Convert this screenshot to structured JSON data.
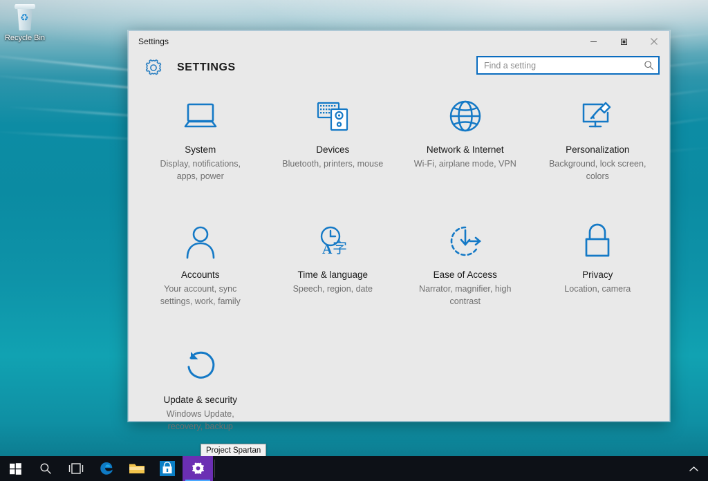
{
  "desktop": {
    "recycle_bin": {
      "label": "Recycle Bin",
      "icon": "recycle-bin-icon"
    },
    "wallpaper_colors": {
      "top": "#b9cdd4",
      "mid": "#0b8ba2",
      "bottom": "#0a6e82"
    }
  },
  "window": {
    "title": "Settings",
    "header_title": "SETTINGS",
    "header_icon": "gear-icon",
    "controls": {
      "minimize": "minimize-icon",
      "maximize": "maximize-icon",
      "close": "close-icon"
    },
    "accent_color": "#0a6cbf",
    "icon_color": "#1479c6",
    "background": "#e9e9e9"
  },
  "search": {
    "placeholder": "Find a setting",
    "value": "",
    "icon": "search-icon"
  },
  "tiles": [
    {
      "name": "System",
      "description": "Display, notifications, apps, power",
      "icon": "laptop-icon"
    },
    {
      "name": "Devices",
      "description": "Bluetooth, printers, mouse",
      "icon": "keyboard-and-speaker-icon"
    },
    {
      "name": "Network & Internet",
      "description": "Wi-Fi, airplane mode, VPN",
      "icon": "globe-icon"
    },
    {
      "name": "Personalization",
      "description": "Background, lock screen, colors",
      "icon": "monitor-paintbrush-icon"
    },
    {
      "name": "Accounts",
      "description": "Your account, sync settings, work, family",
      "icon": "person-icon"
    },
    {
      "name": "Time & language",
      "description": "Speech, region, date",
      "icon": "clock-language-icon"
    },
    {
      "name": "Ease of Access",
      "description": "Narrator, magnifier, high contrast",
      "icon": "accessibility-arrows-icon"
    },
    {
      "name": "Privacy",
      "description": "Location, camera",
      "icon": "padlock-icon"
    },
    {
      "name": "Update & security",
      "description": "Windows Update, recovery, backup",
      "icon": "refresh-circle-icon"
    }
  ],
  "taskbar": {
    "background": "#0d1117",
    "items": [
      {
        "name": "start-button",
        "icon": "windows-logo-icon",
        "label": "Start"
      },
      {
        "name": "search-button",
        "icon": "search-icon",
        "label": "Search"
      },
      {
        "name": "task-view-button",
        "icon": "task-view-icon",
        "label": "Task View"
      },
      {
        "name": "edge-button",
        "icon": "edge-icon",
        "label": "Microsoft Edge"
      },
      {
        "name": "file-explorer-button",
        "icon": "folder-icon",
        "label": "File Explorer"
      },
      {
        "name": "store-button",
        "icon": "store-bag-icon",
        "label": "Store"
      },
      {
        "name": "settings-button",
        "icon": "gear-icon",
        "label": "Settings",
        "active": true
      }
    ],
    "tray": [
      {
        "name": "show-hidden-icons-button",
        "icon": "chevron-up-icon"
      }
    ]
  },
  "tooltip": {
    "text": "Project Spartan"
  }
}
